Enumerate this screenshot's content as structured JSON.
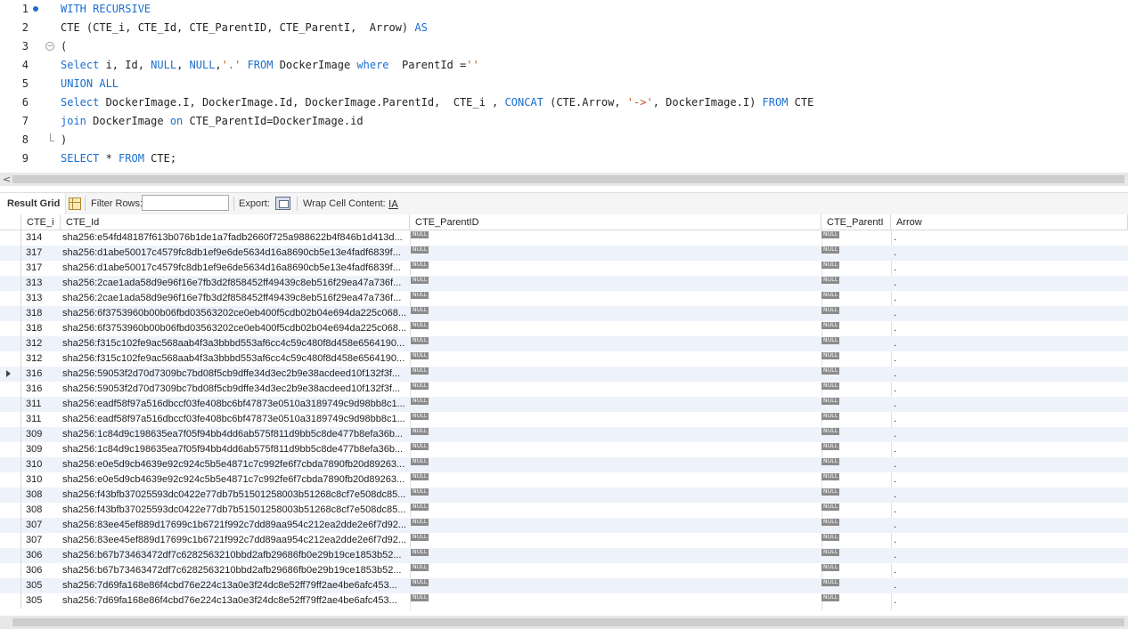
{
  "editor": {
    "lines": [
      {
        "n": "1",
        "marker": true,
        "tokens": [
          {
            "t": "WITH RECURSIVE",
            "c": "kw"
          }
        ]
      },
      {
        "n": "2",
        "tokens": [
          {
            "t": "CTE (CTE_i, CTE_Id, CTE_ParentID, CTE_ParentI,  Arrow) ",
            "c": ""
          },
          {
            "t": "AS",
            "c": "kw"
          }
        ]
      },
      {
        "n": "3",
        "fold": "start",
        "tokens": [
          {
            "t": "(",
            "c": ""
          }
        ]
      },
      {
        "n": "4",
        "tokens": [
          {
            "t": "Select",
            "c": "kw"
          },
          {
            "t": " i, Id, ",
            "c": ""
          },
          {
            "t": "NULL",
            "c": "kw"
          },
          {
            "t": ", ",
            "c": ""
          },
          {
            "t": "NULL",
            "c": "kw"
          },
          {
            "t": ",",
            "c": ""
          },
          {
            "t": "'.'",
            "c": "str"
          },
          {
            "t": " ",
            "c": ""
          },
          {
            "t": "FROM",
            "c": "kw"
          },
          {
            "t": " DockerImage ",
            "c": ""
          },
          {
            "t": "where",
            "c": "kw"
          },
          {
            "t": "  ParentId =",
            "c": ""
          },
          {
            "t": "''",
            "c": "str"
          }
        ]
      },
      {
        "n": "5",
        "tokens": [
          {
            "t": "UNION ALL",
            "c": "kw"
          }
        ]
      },
      {
        "n": "6",
        "tokens": [
          {
            "t": "Select",
            "c": "kw"
          },
          {
            "t": " DockerImage.I, DockerImage.Id, DockerImage.ParentId,  CTE_i , ",
            "c": ""
          },
          {
            "t": "CONCAT",
            "c": "kw"
          },
          {
            "t": " (CTE.Arrow, ",
            "c": ""
          },
          {
            "t": "'->'",
            "c": "str"
          },
          {
            "t": ", DockerImage.I) ",
            "c": ""
          },
          {
            "t": "FROM",
            "c": "kw"
          },
          {
            "t": " CTE",
            "c": ""
          }
        ]
      },
      {
        "n": "7",
        "tokens": [
          {
            "t": "join",
            "c": "kw"
          },
          {
            "t": " DockerImage ",
            "c": ""
          },
          {
            "t": "on",
            "c": "kw"
          },
          {
            "t": " CTE_ParentId=DockerImage.id",
            "c": ""
          }
        ]
      },
      {
        "n": "8",
        "fold": "end",
        "tokens": [
          {
            "t": ")",
            "c": ""
          }
        ]
      },
      {
        "n": "9",
        "tokens": [
          {
            "t": "SELECT",
            "c": "kw"
          },
          {
            "t": " * ",
            "c": ""
          },
          {
            "t": "FROM",
            "c": "kw"
          },
          {
            "t": " CTE;",
            "c": ""
          }
        ]
      }
    ]
  },
  "toolbar": {
    "result_grid": "Result Grid",
    "filter_rows": "Filter Rows:",
    "filter_value": "",
    "export": "Export:",
    "wrap": "Wrap Cell Content:",
    "wrap_icon": "IA"
  },
  "grid": {
    "columns": [
      "CTE_i",
      "CTE_Id",
      "CTE_ParentID",
      "CTE_ParentI",
      "Arrow"
    ],
    "null_label": "NULL",
    "selected_row": 9,
    "rows": [
      [
        "314",
        "sha256:e54fd48187f613b076b1de1a7fadb2660f725a988622b4f846b1d413d...",
        "."
      ],
      [
        "317",
        "sha256:d1abe50017c4579fc8db1ef9e6de5634d16a8690cb5e13e4fadf6839f...",
        "."
      ],
      [
        "317",
        "sha256:d1abe50017c4579fc8db1ef9e6de5634d16a8690cb5e13e4fadf6839f...",
        "."
      ],
      [
        "313",
        "sha256:2cae1ada58d9e96f16e7fb3d2f858452ff49439c8eb516f29ea47a736f...",
        "."
      ],
      [
        "313",
        "sha256:2cae1ada58d9e96f16e7fb3d2f858452ff49439c8eb516f29ea47a736f...",
        "."
      ],
      [
        "318",
        "sha256:6f3753960b00b06fbd03563202ce0eb400f5cdb02b04e694da225c068...",
        "."
      ],
      [
        "318",
        "sha256:6f3753960b00b06fbd03563202ce0eb400f5cdb02b04e694da225c068...",
        "."
      ],
      [
        "312",
        "sha256:f315c102fe9ac568aab4f3a3bbbd553af6cc4c59c480f8d458e6564190...",
        "."
      ],
      [
        "312",
        "sha256:f315c102fe9ac568aab4f3a3bbbd553af6cc4c59c480f8d458e6564190...",
        "."
      ],
      [
        "316",
        "sha256:59053f2d70d7309bc7bd08f5cb9dffe34d3ec2b9e38acdeed10f132f3f...",
        "."
      ],
      [
        "316",
        "sha256:59053f2d70d7309bc7bd08f5cb9dffe34d3ec2b9e38acdeed10f132f3f...",
        "."
      ],
      [
        "311",
        "sha256:eadf58f97a516dbccf03fe408bc6bf47873e0510a3189749c9d98bb8c1...",
        "."
      ],
      [
        "311",
        "sha256:eadf58f97a516dbccf03fe408bc6bf47873e0510a3189749c9d98bb8c1...",
        "."
      ],
      [
        "309",
        "sha256:1c84d9c198635ea7f05f94bb4dd6ab575f811d9bb5c8de477b8efa36b...",
        "."
      ],
      [
        "309",
        "sha256:1c84d9c198635ea7f05f94bb4dd6ab575f811d9bb5c8de477b8efa36b...",
        "."
      ],
      [
        "310",
        "sha256:e0e5d9cb4639e92c924c5b5e4871c7c992fe6f7cbda7890fb20d89263...",
        "."
      ],
      [
        "310",
        "sha256:e0e5d9cb4639e92c924c5b5e4871c7c992fe6f7cbda7890fb20d89263...",
        "."
      ],
      [
        "308",
        "sha256:f43bfb37025593dc0422e77db7b51501258003b51268c8cf7e508dc85...",
        "."
      ],
      [
        "308",
        "sha256:f43bfb37025593dc0422e77db7b51501258003b51268c8cf7e508dc85...",
        "."
      ],
      [
        "307",
        "sha256:83ee45ef889d17699c1b6721f992c7dd89aa954c212ea2dde2e6f7d92...",
        "."
      ],
      [
        "307",
        "sha256:83ee45ef889d17699c1b6721f992c7dd89aa954c212ea2dde2e6f7d92...",
        "."
      ],
      [
        "306",
        "sha256:b67b73463472df7c6282563210bbd2afb29686fb0e29b19ce1853b52...",
        "."
      ],
      [
        "306",
        "sha256:b67b73463472df7c6282563210bbd2afb29686fb0e29b19ce1853b52...",
        "."
      ],
      [
        "305",
        "sha256:7d69fa168e86f4cbd76e224c13a0e3f24dc8e52ff79ff2ae4be6afc453...",
        "."
      ],
      [
        "305",
        "sha256:7d69fa168e86f4cbd76e224c13a0e3f24dc8e52ff79ff2ae4be6afc453...",
        "."
      ]
    ]
  },
  "colors": {
    "keyword": "#1a6fcf",
    "string": "#c74e0f",
    "alt_row": "#eef3fb"
  }
}
